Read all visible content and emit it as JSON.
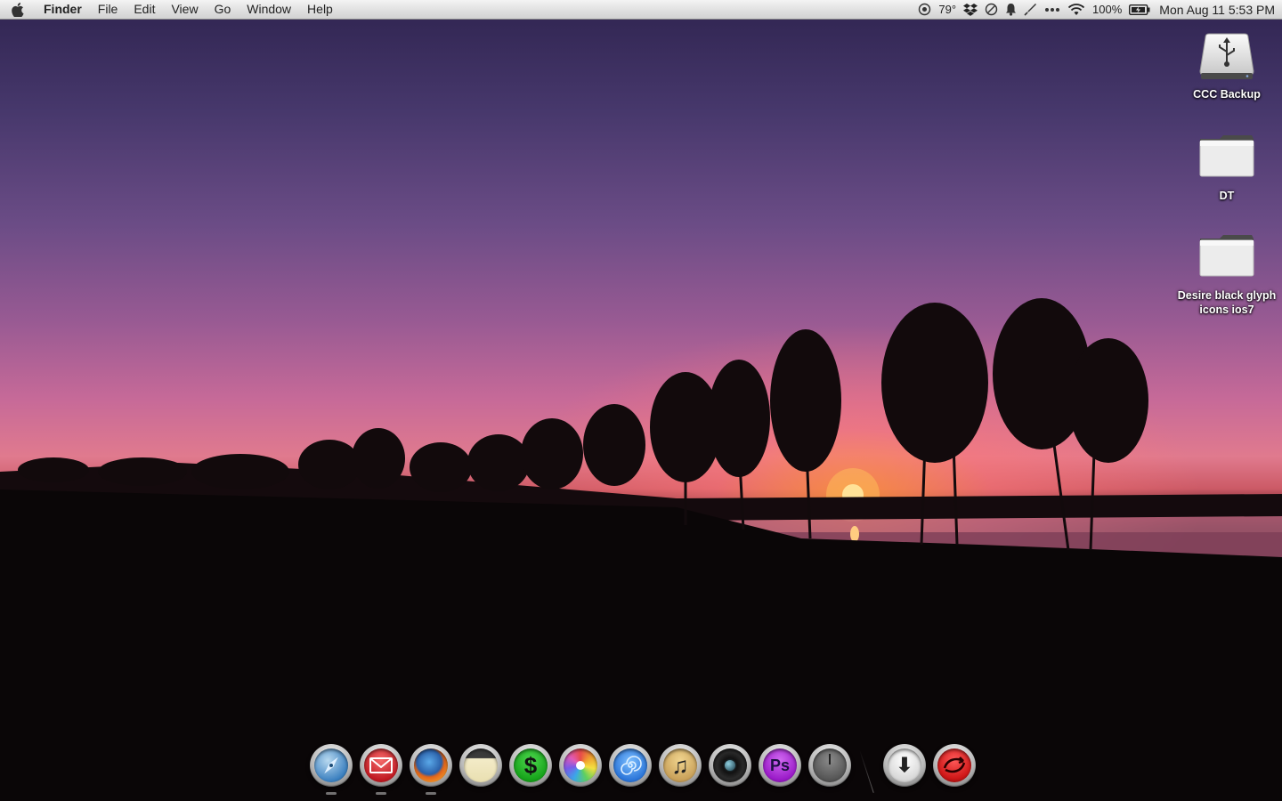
{
  "menubar": {
    "app_name": "Finder",
    "menus": [
      "File",
      "Edit",
      "View",
      "Go",
      "Window",
      "Help"
    ],
    "status": {
      "temperature": "79°",
      "battery": "100%",
      "clock": "Mon Aug 11  5:53 PM"
    },
    "icons": [
      "apple-icon",
      "weather-icon",
      "dropbox-icon",
      "do-not-disturb-icon",
      "notification-bell-icon",
      "keychain-pen-icon",
      "more-dots-icon",
      "wifi-icon",
      "battery-icon"
    ]
  },
  "desktop": {
    "items": [
      {
        "label": "CCC Backup",
        "icon": "usb-drive-icon"
      },
      {
        "label": "DT",
        "icon": "folder-icon"
      },
      {
        "label": "Desire black glyph icons ios7",
        "icon": "folder-icon"
      }
    ]
  },
  "dock": {
    "apps": [
      {
        "icon": "safari-icon",
        "color": "#3a7fbf"
      },
      {
        "icon": "mail-icon",
        "color": "#d0202a"
      },
      {
        "icon": "firefox-icon",
        "color": "#e0641a"
      },
      {
        "icon": "notes-icon",
        "color": "#f3ebc8"
      },
      {
        "icon": "money-icon",
        "color": "#16a31a",
        "glyph": "$"
      },
      {
        "icon": "photos-icon",
        "color": "#e84a4a"
      },
      {
        "icon": "spiral-app-icon",
        "color": "#2a74d8"
      },
      {
        "icon": "itunes-icon",
        "color": "#c9a15a",
        "glyph": "♫"
      },
      {
        "icon": "camera-icon",
        "color": "#1b1b1b"
      },
      {
        "icon": "photoshop-icon",
        "color": "#9a1ac8",
        "glyph": "Ps"
      },
      {
        "icon": "unknown-app-icon",
        "color": "#555555"
      }
    ],
    "stack": [
      {
        "icon": "downloads-icon",
        "color": "#d8d8d8",
        "glyph": "⬇"
      },
      {
        "icon": "trash-icon",
        "color": "#d01818"
      }
    ]
  }
}
